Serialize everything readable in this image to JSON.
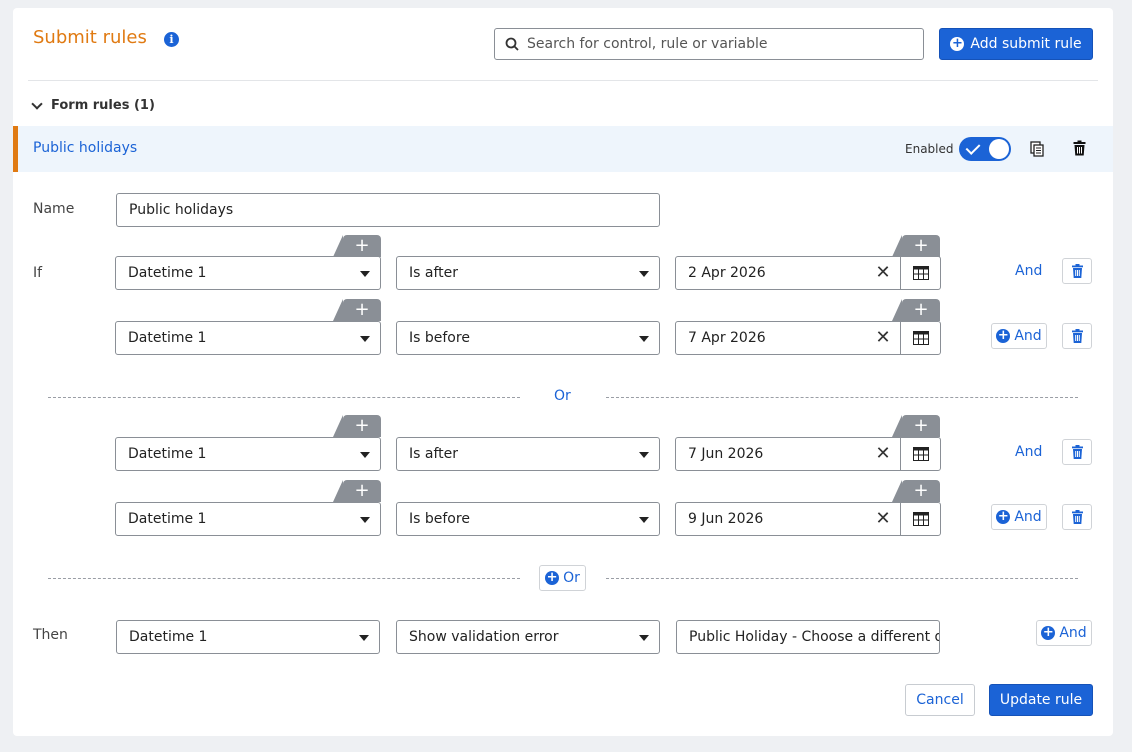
{
  "header": {
    "title": "Submit rules",
    "search_placeholder": "Search for control, rule or variable",
    "add_button_label": "Add submit rule"
  },
  "section": {
    "label": "Form rules (1)"
  },
  "rule": {
    "name": "Public holidays",
    "enabled_label": "Enabled",
    "enabled": true
  },
  "form": {
    "name_label": "Name",
    "name_value": "Public holidays",
    "if_label": "If",
    "then_label": "Then",
    "or_label": "Or",
    "add_or_label": "Or",
    "and_label": "And"
  },
  "conditions": [
    {
      "field": "Datetime 1",
      "operator": "Is after",
      "value": "2 Apr 2026"
    },
    {
      "field": "Datetime 1",
      "operator": "Is before",
      "value": "7 Apr 2026"
    },
    {
      "field": "Datetime 1",
      "operator": "Is after",
      "value": "7 Jun 2026"
    },
    {
      "field": "Datetime 1",
      "operator": "Is before",
      "value": "9 Jun 2026"
    }
  ],
  "action": {
    "field": "Datetime 1",
    "action": "Show validation error",
    "message": "Public Holiday - Choose a different date"
  },
  "footer": {
    "cancel_label": "Cancel",
    "update_label": "Update rule"
  },
  "colors": {
    "accent": "#e07a12",
    "primary": "#1b63d6",
    "rule_bar_bg": "#eef5fc"
  }
}
